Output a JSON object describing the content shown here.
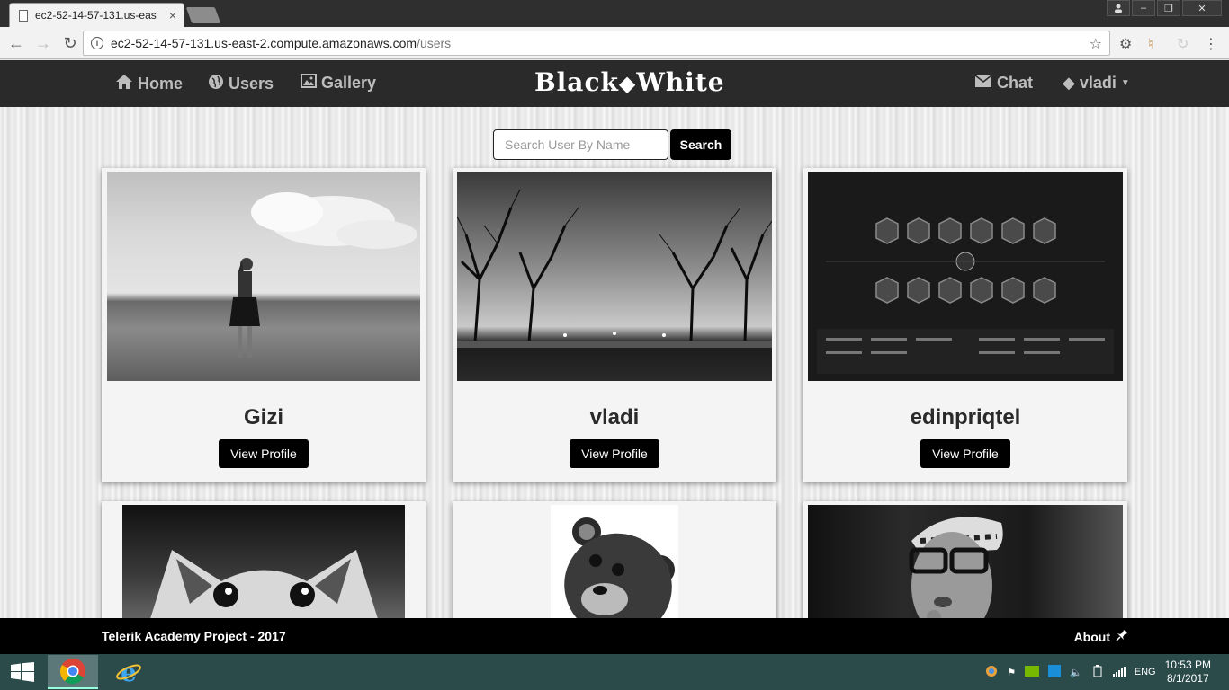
{
  "browser": {
    "tab_title": "ec2-52-14-57-131.us-eas",
    "tab_close": "×",
    "url_host": "ec2-52-14-57-131.us-east-2.compute.amazonaws.com",
    "url_path": "/users",
    "window_controls": [
      "–",
      "❐",
      "✕"
    ]
  },
  "navbar": {
    "home": "Home",
    "users": "Users",
    "gallery": "Gallery",
    "brand_left": "Black",
    "brand_right": "White",
    "chat": "Chat",
    "user": "vladi",
    "icons": [
      "home-icon",
      "globe-icon",
      "picture-icon",
      "envelope-icon",
      "diamond-icon"
    ]
  },
  "search": {
    "placeholder": "Search User By Name",
    "button": "Search"
  },
  "users": [
    {
      "name": "Gizi",
      "button": "View Profile"
    },
    {
      "name": "vladi",
      "button": "View Profile"
    },
    {
      "name": "edinpriqtel",
      "button": "View Profile"
    }
  ],
  "footer": {
    "left": "Telerik Academy Project - 2017",
    "right": "About"
  },
  "taskbar": {
    "lang": "ENG",
    "time": "10:53 PM",
    "date": "8/1/2017"
  }
}
